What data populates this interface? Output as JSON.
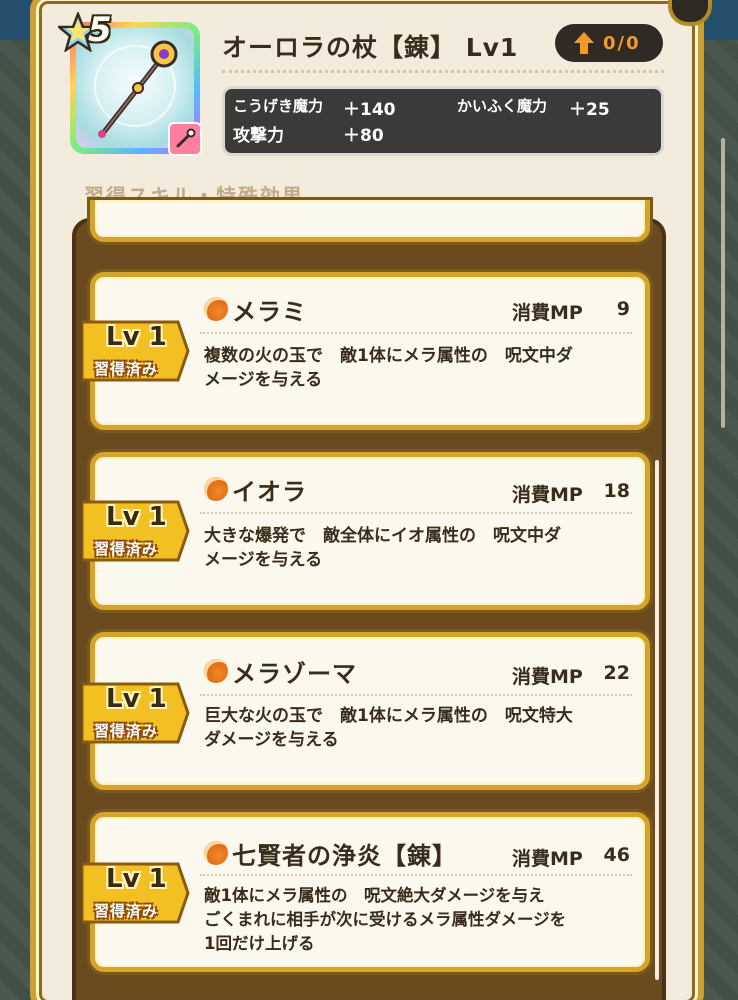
{
  "header": {
    "rarity": "5",
    "title": "オーロラの杖【錬】 Lv1",
    "upgrade_count": "0/0",
    "stats": [
      {
        "label": "こうげき魔力",
        "value": "＋140"
      },
      {
        "label": "かいふく魔力",
        "value": "＋25"
      },
      {
        "label": "攻撃力",
        "value": "＋80"
      }
    ]
  },
  "section_heading": "習得スキル・特殊効果",
  "skills": [
    {
      "name": "メラミ",
      "mp_label": "消費MP",
      "mp_value": "9",
      "level": "Lv 1",
      "status": "習得済み",
      "description": "複数の火の玉で　敵1体にメラ属性の　呪文中ダ\nメージを与える"
    },
    {
      "name": "イオラ",
      "mp_label": "消費MP",
      "mp_value": "18",
      "level": "Lv 1",
      "status": "習得済み",
      "description": "大きな爆発で　敵全体にイオ属性の　呪文中ダ\nメージを与える"
    },
    {
      "name": "メラゾーマ",
      "mp_label": "消費MP",
      "mp_value": "22",
      "level": "Lv 1",
      "status": "習得済み",
      "description": "巨大な火の玉で　敵1体にメラ属性の　呪文特大\nダメージを与える"
    },
    {
      "name": "七賢者の浄炎【錬】",
      "mp_label": "消費MP",
      "mp_value": "46",
      "level": "Lv 1",
      "status": "習得済み",
      "description": "敵1体にメラ属性の　呪文絶大ダメージを与え\nごくまれに相手が次に受けるメラ属性ダメージを\n1回だけ上げる"
    }
  ],
  "colors": {
    "panel": "#f3ecdc",
    "gold_border": "#d4a52a",
    "list_frame": "#6b4a20",
    "badge": "#f2c023",
    "fire_icon": "#e26a12"
  }
}
